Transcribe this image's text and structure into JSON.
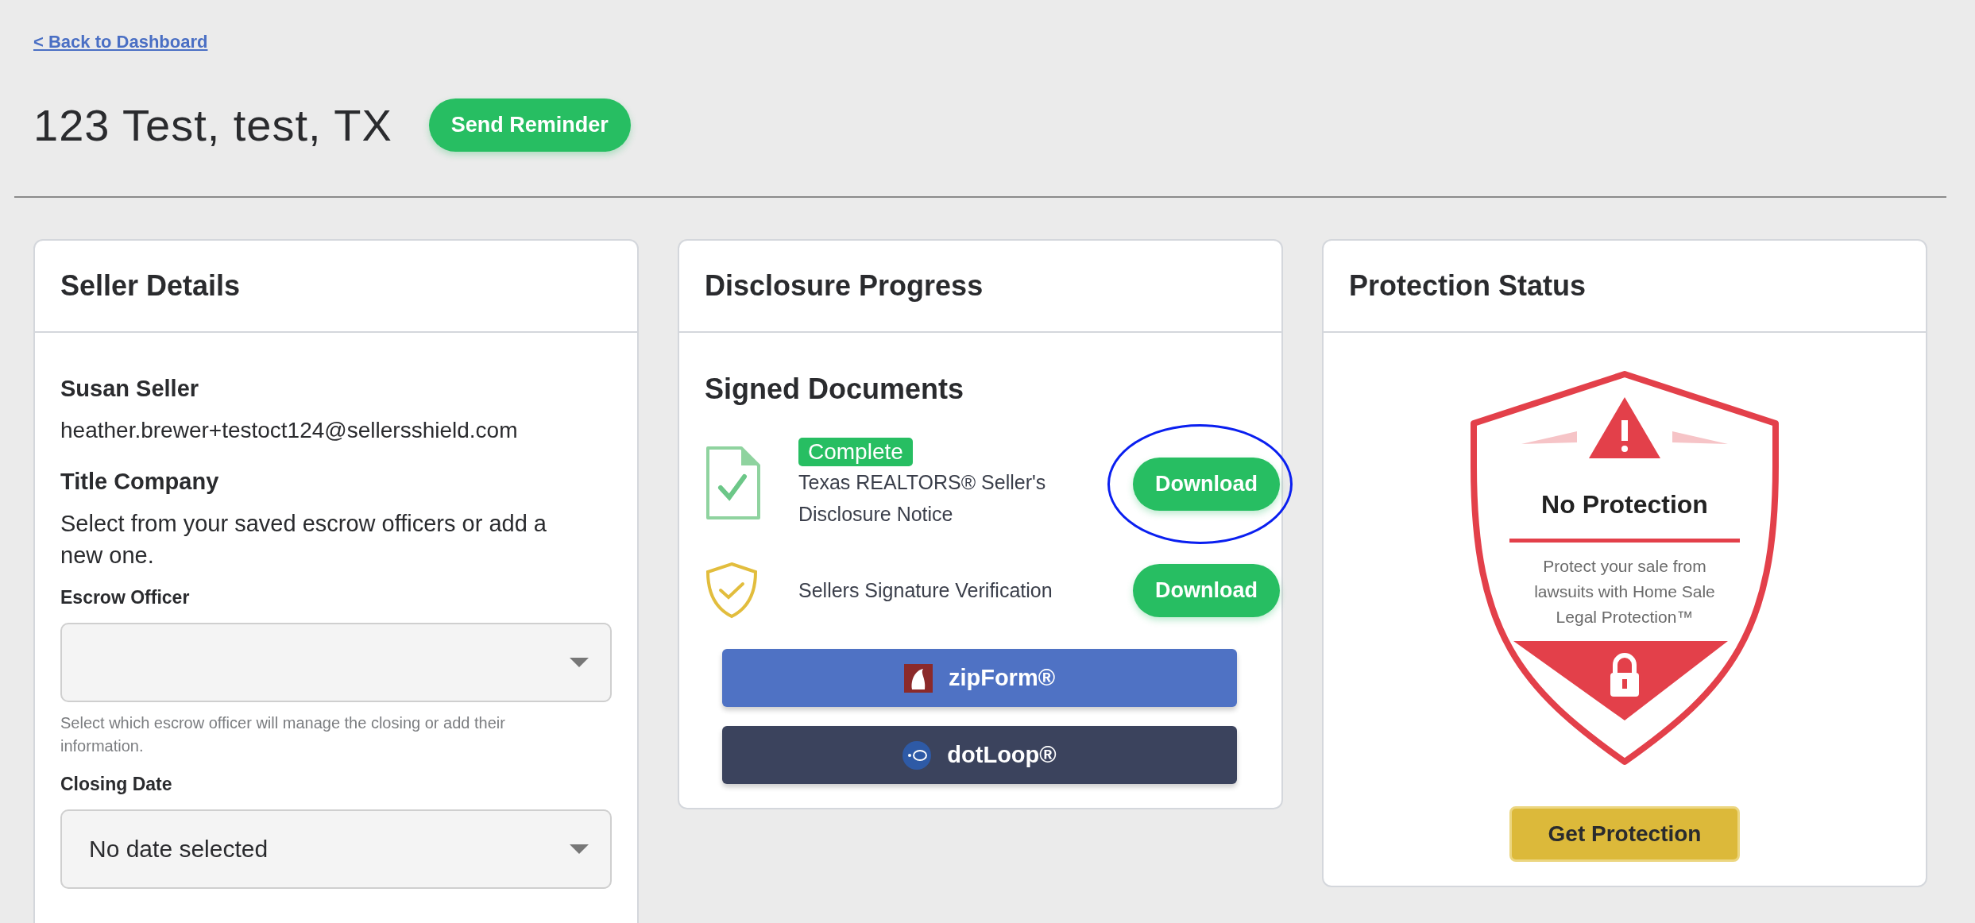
{
  "back_link": "< Back to Dashboard",
  "title": "123 Test, test, TX",
  "send_reminder": "Send Reminder",
  "seller_details": {
    "heading": "Seller Details",
    "name": "Susan Seller",
    "email": "heather.brewer+testoct124@sellersshield.com",
    "section_heading": "Title Company",
    "description": "Select from your saved escrow officers or add a new one.",
    "fields": [
      {
        "label": "Escrow Officer",
        "hint": "Select which escrow officer will manage the closing or add their information."
      },
      {
        "label": "Closing Date",
        "value": "No date selected"
      }
    ]
  },
  "disclosure_progress": {
    "heading": "Disclosure Progress",
    "subheading": "Signed Documents",
    "documents": [
      {
        "kind": "document",
        "badge": "Complete",
        "name": "Texas REALTORS® Seller's Disclosure Notice",
        "button": "Download",
        "highlighted": true
      },
      {
        "kind": "verification",
        "name": "Sellers Signature Verification",
        "button": "Download",
        "highlighted": false
      }
    ],
    "integrations": [
      {
        "kind": "zipform",
        "label": "zipForm®"
      },
      {
        "kind": "dotloop",
        "label": "dotLoop®"
      }
    ]
  },
  "protection_status": {
    "heading": "Protection Status",
    "badge_title": "No Protection",
    "badge_text": "Protect your sale from lawsuits with Home Sale Legal Protection™",
    "button": "Get Protection"
  }
}
